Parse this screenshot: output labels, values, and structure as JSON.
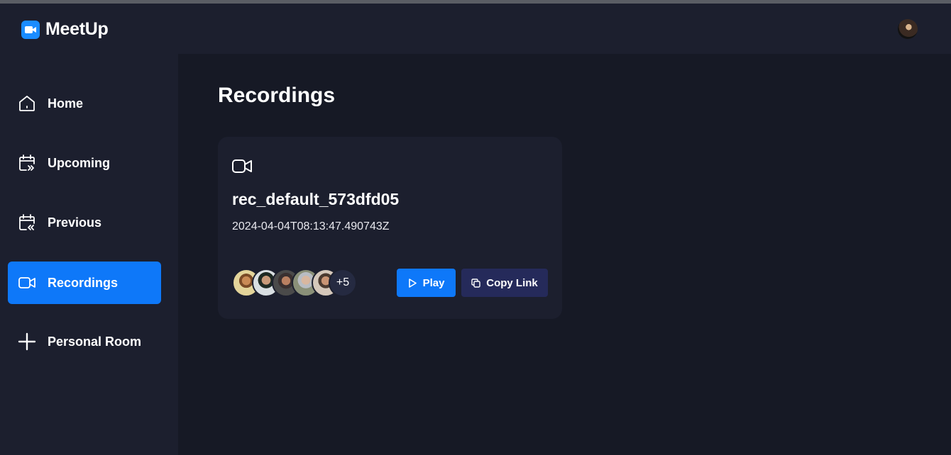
{
  "app": {
    "name": "MeetUp"
  },
  "colors": {
    "accent": "#0E78F9",
    "sidebar": "#1C1F2E",
    "background": "#161925",
    "card": "#1C1F2E",
    "secondary_button": "#252A5A"
  },
  "sidebar": {
    "items": [
      {
        "label": "Home",
        "icon": "home-icon",
        "active": false
      },
      {
        "label": "Upcoming",
        "icon": "calendar-upcoming-icon",
        "active": false
      },
      {
        "label": "Previous",
        "icon": "calendar-previous-icon",
        "active": false
      },
      {
        "label": "Recordings",
        "icon": "video-icon",
        "active": true
      },
      {
        "label": "Personal Room",
        "icon": "plus-icon",
        "active": false
      }
    ]
  },
  "main": {
    "title": "Recordings",
    "recording": {
      "icon": "video-icon",
      "title": "rec_default_573dfd05",
      "date": "2024-04-04T08:13:47.490743Z",
      "attendees_more": "+5",
      "play_label": "Play",
      "copy_label": "Copy Link"
    }
  }
}
